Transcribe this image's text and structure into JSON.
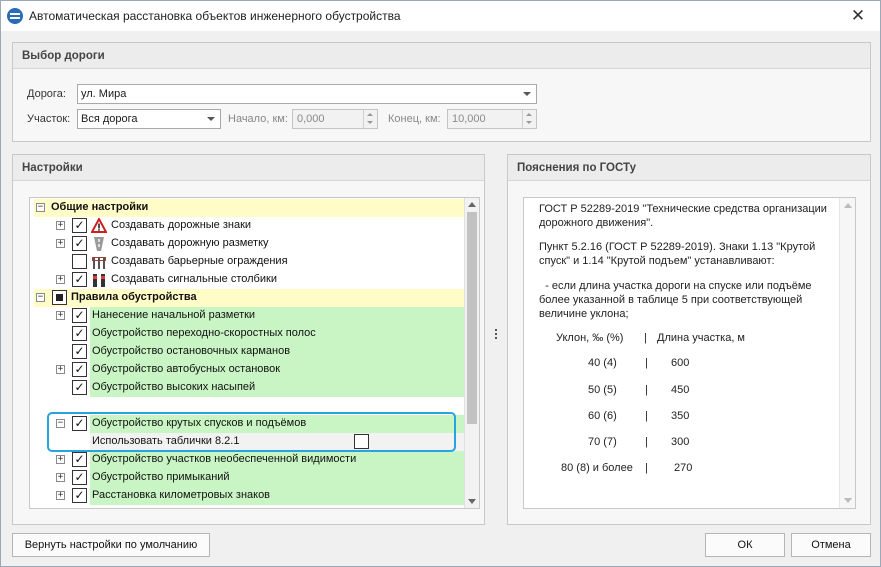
{
  "window": {
    "title": "Автоматическая расстановка объектов инженерного обустройства"
  },
  "road_panel": {
    "header": "Выбор дороги",
    "road_label": "Дорога:",
    "road_value": "ул. Мира",
    "section_label": "Участок:",
    "section_value": "Вся дорога",
    "start_label": "Начало, км:",
    "start_value": "0,000",
    "end_label": "Конец, км:",
    "end_value": "10,000"
  },
  "settings_panel": {
    "header": "Настройки",
    "groups": [
      {
        "label": "Общие настройки",
        "items": [
          {
            "label": "Создавать дорожные знаки",
            "icon": "road-sign-icon"
          },
          {
            "label": "Создавать дорожную разметку",
            "icon": "road-marking-icon"
          },
          {
            "label": "Создавать барьерные ограждения",
            "icon": "barrier-icon"
          },
          {
            "label": "Создавать сигнальные столбики",
            "icon": "signal-post-icon"
          }
        ]
      },
      {
        "label": "Правила обустройства",
        "items": [
          {
            "label": "Нанесение начальной разметки"
          },
          {
            "label": "Обустройство переходно-скоростных полос"
          },
          {
            "label": "Обустройство остановочных карманов"
          },
          {
            "label": "Обустройство автобусных остановок"
          },
          {
            "label": "Обустройство высоких насыпей"
          },
          {
            "label": "Обустройство крутых спусков и подъёмов"
          },
          {
            "label": "Использовать таблички 8.2.1"
          },
          {
            "label": "Обустройство участков необеспеченной видимости"
          },
          {
            "label": "Обустройство примыканий"
          },
          {
            "label": "Расстановка километровых знаков"
          }
        ]
      }
    ]
  },
  "gost_panel": {
    "header": "Пояснения по ГОСТу",
    "para1": "ГОСТ Р 52289-2019 \"Технические средства организации дорожного движения\".",
    "para2": "Пункт 5.2.16 (ГОСТ Р 52289-2019). Знаки 1.13 \"Крутой спуск\" и 1.14 \"Крутой подъем\" устанавливают:",
    "para3": "  - если длина участка дороги на спуске или подъёме более указанной в таблице 5 при соответствующей величине уклона;",
    "table_header_slope": "Уклон, ‰ (%)",
    "table_sep": "|",
    "table_header_length": "Длина участка, м",
    "rows": [
      {
        "slope": "40 (4)",
        "length": "600"
      },
      {
        "slope": "50 (5)",
        "length": "450"
      },
      {
        "slope": "60 (6)",
        "length": "350"
      },
      {
        "slope": "70 (7)",
        "length": "300"
      },
      {
        "slope": "80 (8) и более",
        "length": "270"
      }
    ]
  },
  "buttons": {
    "reset": "Вернуть настройки по умолчанию",
    "ok": "ОК",
    "cancel": "Отмена"
  },
  "colors": {
    "group_bg": "#fffcc8",
    "rule_bg": "#c9f5c4",
    "highlight": "#29a3e0"
  }
}
